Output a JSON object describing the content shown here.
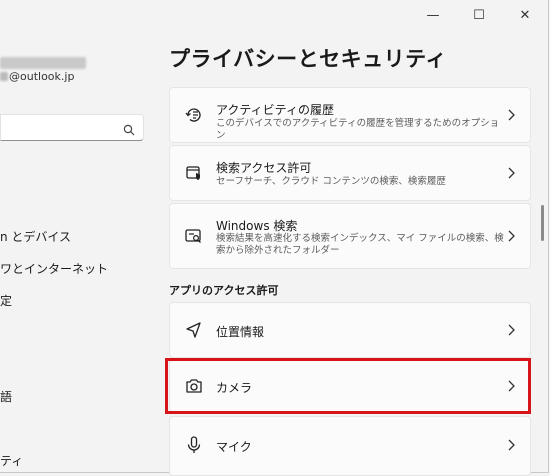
{
  "window": {
    "minimize": "—",
    "maximize": "☐",
    "close": "✕"
  },
  "account": {
    "email_suffix": "@outlook.jp"
  },
  "search": {
    "placeholder": ""
  },
  "nav": {
    "items": [
      {
        "label": "n とデバイス"
      },
      {
        "label": "ワとインターネット"
      },
      {
        "label": "定"
      },
      {
        "label": "語"
      },
      {
        "label": "ティ"
      }
    ]
  },
  "main": {
    "title": "プライバシーとセキュリティ",
    "cards": [
      {
        "title": "アクティビティの履歴",
        "desc": "このデバイスでのアクティビティの履歴を管理するためのオプション",
        "icon": "activity-history-icon"
      },
      {
        "title": "検索アクセス許可",
        "desc": "セーフサーチ、クラウド コンテンツの検索、検索履歴",
        "icon": "search-permissions-icon"
      },
      {
        "title": "Windows 検索",
        "desc": "検索結果を高速化する検索インデックス、マイ ファイルの検索、検索から除外されたフォルダー",
        "icon": "windows-search-icon"
      }
    ],
    "section_label": "アプリのアクセス許可",
    "app_permissions": [
      {
        "title": "位置情報",
        "icon": "location-icon"
      },
      {
        "title": "カメラ",
        "icon": "camera-icon"
      },
      {
        "title": "マイク",
        "icon": "microphone-icon"
      }
    ]
  }
}
